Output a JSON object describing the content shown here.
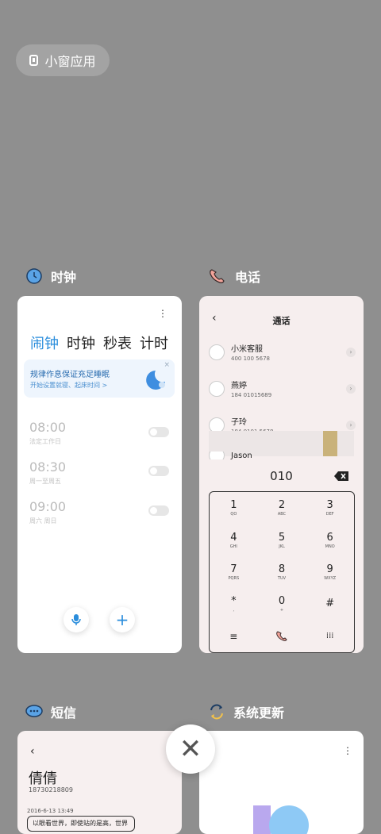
{
  "small_window": {
    "label": "小窗应用"
  },
  "clock": {
    "app_name": "时钟",
    "tabs": [
      "闹钟",
      "时钟",
      "秒表",
      "计时"
    ],
    "banner_title": "规律作息保证充足睡眠",
    "banner_sub": "开始设置就寝、起床时间 >",
    "alarms": [
      {
        "time": "08:00",
        "sub": "法定工作日"
      },
      {
        "time": "08:30",
        "sub": "周一至周五"
      },
      {
        "time": "09:00",
        "sub": "周六 周日"
      }
    ]
  },
  "phone": {
    "app_name": "电话",
    "title": "通话",
    "contacts": [
      {
        "name": "小米客服",
        "number": "400 100 5678"
      },
      {
        "name": "燕婷",
        "number": "184 01015689"
      },
      {
        "name": "子玲",
        "number": "184 0101 5678"
      },
      {
        "name": "Jason",
        "number": ""
      }
    ],
    "dial_input": "010",
    "keys": [
      {
        "d": "1",
        "l": "QO"
      },
      {
        "d": "2",
        "l": "ABC"
      },
      {
        "d": "3",
        "l": "DEF"
      },
      {
        "d": "4",
        "l": "GHI"
      },
      {
        "d": "5",
        "l": "JKL"
      },
      {
        "d": "6",
        "l": "MNO"
      },
      {
        "d": "7",
        "l": "PQRS"
      },
      {
        "d": "8",
        "l": "TUV"
      },
      {
        "d": "9",
        "l": "WXYZ"
      },
      {
        "d": "*",
        "l": ","
      },
      {
        "d": "0",
        "l": "+"
      },
      {
        "d": "#",
        "l": ""
      }
    ]
  },
  "sms": {
    "app_name": "短信",
    "contact": "倩倩",
    "number": "18730218809",
    "date": "2016-6-13 13:49",
    "message": "以眼看世界，即使站的是高，世界"
  },
  "update": {
    "app_name": "系统更新"
  },
  "colors": {
    "accent": "#2a8ddc",
    "background": "#8f8f8f"
  }
}
